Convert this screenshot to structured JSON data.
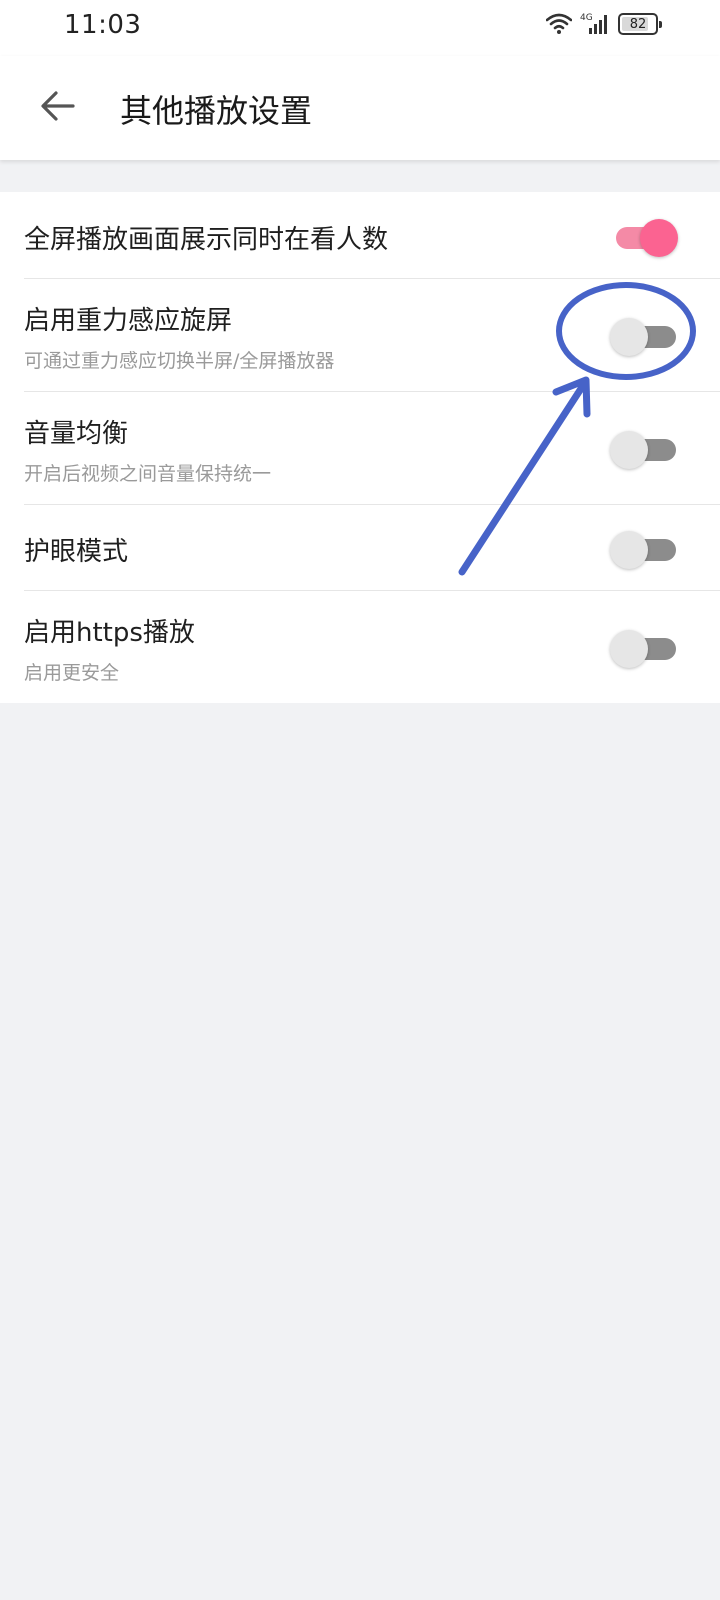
{
  "status_bar": {
    "time": "11:03",
    "network": "4G",
    "battery": "82",
    "battery_level": 0.82
  },
  "header": {
    "title": "其他播放设置",
    "back_icon": "arrow-left-icon"
  },
  "settings": [
    {
      "title": "全屏播放画面展示同时在看人数",
      "subtitle": "",
      "enabled": true
    },
    {
      "title": "启用重力感应旋屏",
      "subtitle": "可通过重力感应切换半屏/全屏播放器",
      "enabled": false
    },
    {
      "title": "音量均衡",
      "subtitle": "开启后视频之间音量保持统一",
      "enabled": false
    },
    {
      "title": "护眼模式",
      "subtitle": "",
      "enabled": false
    },
    {
      "title": "启用https播放",
      "subtitle": "启用更安全",
      "enabled": false
    }
  ],
  "colors": {
    "toggle_on_thumb": "#fb6391",
    "toggle_on_track": "#f48aa6",
    "toggle_off_thumb": "#e6e6e6",
    "toggle_off_track": "#8c8c8c",
    "annotation": "#4763c8",
    "background": "#f1f2f4"
  }
}
